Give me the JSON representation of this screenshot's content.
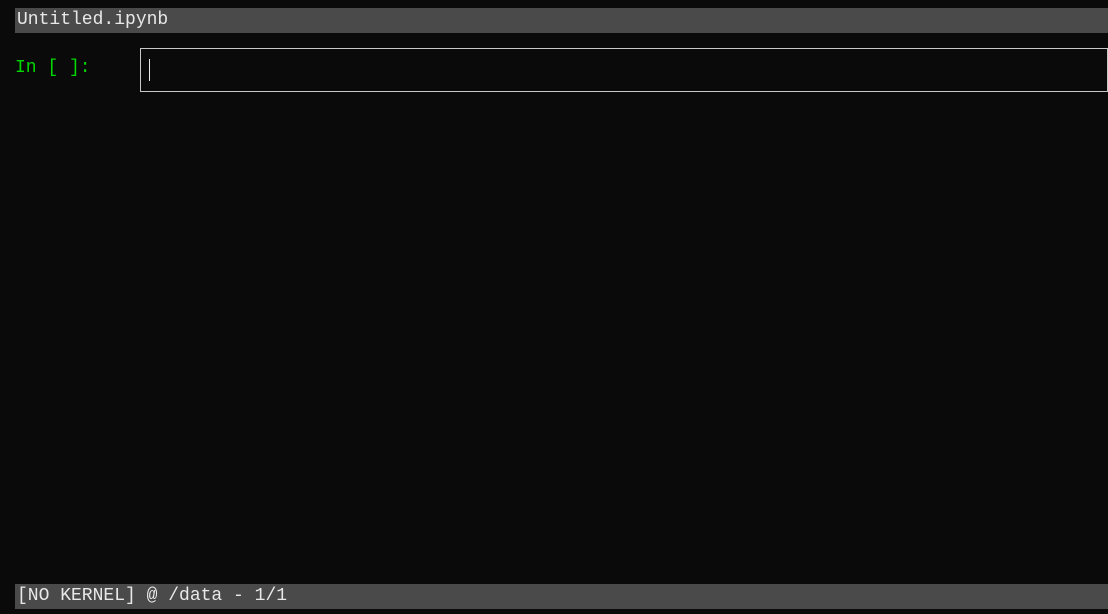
{
  "header": {
    "filename": "Untitled.ipynb"
  },
  "cell": {
    "prompt": "In [ ]:",
    "content": ""
  },
  "status": {
    "text": "[NO KERNEL] @ /data - 1/1"
  }
}
